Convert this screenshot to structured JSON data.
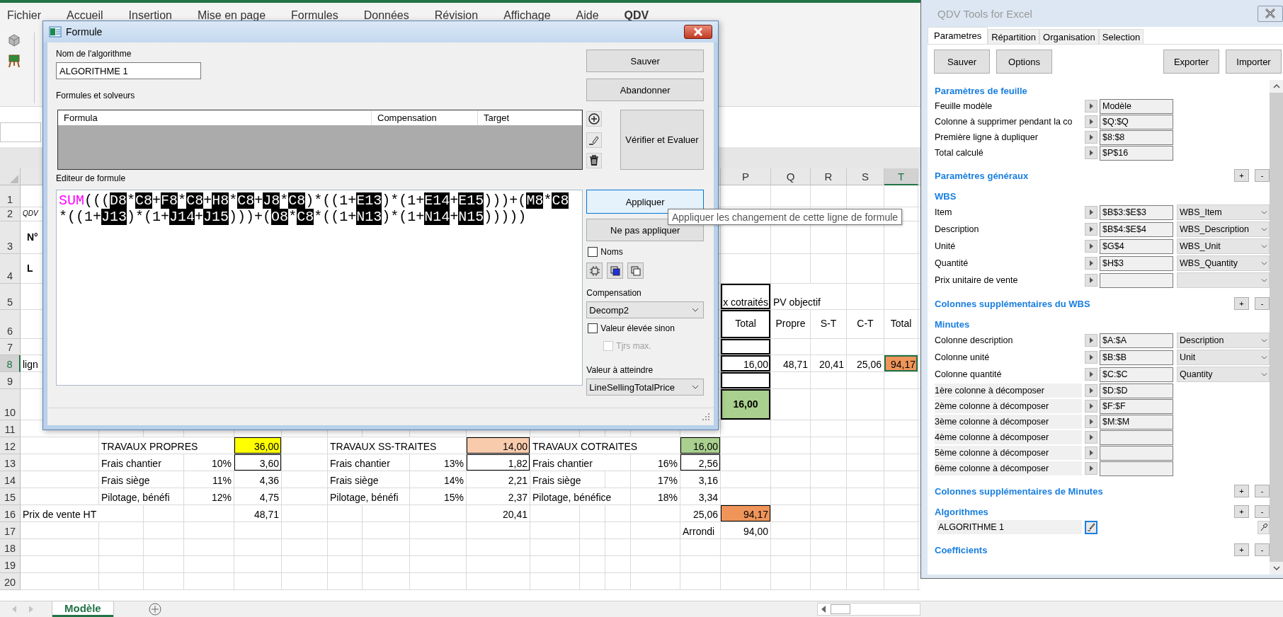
{
  "ribbon_tabs": [
    {
      "label": "Fichier",
      "selected": false
    },
    {
      "label": "Accueil",
      "selected": false
    },
    {
      "label": "Insertion",
      "selected": false
    },
    {
      "label": "Mise en page",
      "selected": false
    },
    {
      "label": "Formules",
      "selected": false
    },
    {
      "label": "Données",
      "selected": false
    },
    {
      "label": "Révision",
      "selected": false
    },
    {
      "label": "Affichage",
      "selected": false
    },
    {
      "label": "Aide",
      "selected": false
    },
    {
      "label": "QDV",
      "selected": true
    }
  ],
  "sheet": {
    "column_headers": [
      {
        "label": "P",
        "selected": false
      },
      {
        "label": "Q",
        "selected": false
      },
      {
        "label": "R",
        "selected": false
      },
      {
        "label": "S",
        "selected": false
      },
      {
        "label": "T",
        "selected": true
      }
    ],
    "rows": [
      {
        "number": "1",
        "selected": false
      },
      {
        "number": "2",
        "selected": false,
        "cells": [
          {
            "kind": "small",
            "text": "QDV"
          }
        ]
      },
      {
        "number": "3",
        "selected": false,
        "cells": [
          {
            "kind": "bold",
            "text": "N°"
          }
        ]
      },
      {
        "number": "4",
        "selected": false,
        "cells": [
          {
            "kind": "bold",
            "text": "L"
          }
        ]
      },
      {
        "number": "5",
        "selected": false,
        "cells": [
          {},
          {},
          {},
          {},
          {},
          {},
          {},
          {},
          {},
          {},
          {},
          {},
          {},
          {},
          {},
          {
            "kind": "number",
            "text": "x cotraités",
            "framed": true
          },
          {
            "kind": "text",
            "text": "PV objectif"
          }
        ]
      },
      {
        "number": "6",
        "selected": false,
        "cells": [
          {},
          {},
          {},
          {},
          {},
          {},
          {},
          {},
          {},
          {},
          {},
          {},
          {},
          {},
          {},
          {
            "kind": "center",
            "text": "Total",
            "framed": true
          },
          {
            "kind": "center",
            "text": "Propre"
          },
          {
            "kind": "center",
            "text": "S-T"
          },
          {
            "kind": "center",
            "text": "C-T"
          },
          {
            "kind": "center",
            "text": "Total"
          }
        ]
      },
      {
        "number": "7",
        "selected": false,
        "cells": [
          {},
          {},
          {},
          {},
          {},
          {},
          {},
          {},
          {},
          {},
          {},
          {},
          {},
          {},
          {},
          {
            "framed": true
          }
        ]
      },
      {
        "number": "8",
        "selected": true,
        "cells": [
          {
            "kind": "text",
            "text": "lign"
          },
          {},
          {},
          {},
          {},
          {},
          {},
          {},
          {},
          {},
          {},
          {},
          {},
          {},
          {},
          {
            "kind": "number",
            "text": "16,00",
            "framed": true
          },
          {
            "kind": "number",
            "text": "48,71"
          },
          {
            "kind": "number",
            "text": "20,41"
          },
          {
            "kind": "number",
            "text": "25,06"
          },
          {
            "kind": "number",
            "text": "94,17",
            "color": "#f0955a"
          }
        ]
      },
      {
        "number": "9",
        "selected": false,
        "cells": [
          {},
          {},
          {},
          {},
          {},
          {},
          {},
          {},
          {},
          {},
          {},
          {},
          {},
          {},
          {},
          {
            "framed": true
          }
        ]
      },
      {
        "number": "10",
        "selected": false,
        "cells": [
          {},
          {},
          {},
          {},
          {},
          {},
          {},
          {},
          {},
          {},
          {},
          {},
          {},
          {},
          {},
          {
            "kind": "total",
            "text": "16,00",
            "color": "#a9d08e",
            "framed": true
          }
        ]
      },
      {
        "number": "11",
        "selected": false
      },
      {
        "number": "12",
        "selected": false,
        "cells": [
          {},
          {
            "kind": "text",
            "text": "TRAVAUX PROPRES"
          },
          {},
          {},
          {
            "kind": "number",
            "text": "36,00",
            "color": "#ffff00",
            "outlined": true
          },
          {},
          {
            "kind": "text",
            "text": "TRAVAUX SS-TRAITES"
          },
          {},
          {},
          {
            "kind": "number",
            "text": "14,00",
            "color": "#f8cbad",
            "outlined": true
          },
          {
            "kind": "text",
            "text": "TRAVAUX COTRAITES"
          },
          {},
          {},
          {},
          {
            "kind": "number",
            "text": "16,00",
            "color": "#a9d08e",
            "outlined": true
          }
        ]
      },
      {
        "number": "13",
        "selected": false,
        "cells": [
          {},
          {
            "kind": "text",
            "text": "Frais chantier"
          },
          {},
          {
            "kind": "number",
            "text": "10%"
          },
          {
            "kind": "number",
            "text": "3,60",
            "outlined": true
          },
          {},
          {
            "kind": "text",
            "text": "Frais chantier"
          },
          {},
          {
            "kind": "number",
            "text": "13%"
          },
          {
            "kind": "number",
            "text": "1,82",
            "outlined": true
          },
          {
            "kind": "text",
            "text": "Frais chantier"
          },
          {},
          {},
          {
            "kind": "number",
            "text": "16%"
          },
          {
            "kind": "number",
            "text": "2,56",
            "outlined": true
          }
        ]
      },
      {
        "number": "14",
        "selected": false,
        "cells": [
          {},
          {
            "kind": "text",
            "text": "Frais siège"
          },
          {},
          {
            "kind": "number",
            "text": "11%"
          },
          {
            "kind": "number",
            "text": "4,36"
          },
          {},
          {
            "kind": "text",
            "text": "Frais siège"
          },
          {},
          {
            "kind": "number",
            "text": "14%"
          },
          {
            "kind": "number",
            "text": "2,21"
          },
          {
            "kind": "text",
            "text": "Frais siège"
          },
          {},
          {},
          {
            "kind": "number",
            "text": "17%"
          },
          {
            "kind": "number",
            "text": "3,16"
          }
        ]
      },
      {
        "number": "15",
        "selected": false,
        "cells": [
          {},
          {
            "kind": "text",
            "text": "Pilotage, bénéfi"
          },
          {},
          {
            "kind": "number",
            "text": "12%"
          },
          {
            "kind": "number",
            "text": "4,75"
          },
          {},
          {
            "kind": "text",
            "text": "Pilotage, bénéfi"
          },
          {},
          {
            "kind": "number",
            "text": "15%"
          },
          {
            "kind": "number",
            "text": "2,37"
          },
          {
            "kind": "text",
            "text": "Pilotage, bénéfice"
          },
          {},
          {},
          {
            "kind": "number",
            "text": "18%"
          },
          {
            "kind": "number",
            "text": "3,34"
          }
        ]
      },
      {
        "number": "16",
        "selected": false,
        "cells": [
          {
            "kind": "text",
            "text": "Prix de vente HT"
          },
          {},
          {},
          {},
          {
            "kind": "number",
            "text": "48,71"
          },
          {},
          {},
          {},
          {},
          {
            "kind": "number",
            "text": "20,41"
          },
          {},
          {},
          {},
          {},
          {
            "kind": "number",
            "text": "25,06"
          },
          {
            "kind": "number",
            "text": "94,17",
            "color": "#f0955a",
            "outlined": true
          }
        ]
      },
      {
        "number": "17",
        "selected": false,
        "cells": [
          {},
          {},
          {},
          {},
          {},
          {},
          {},
          {},
          {},
          {},
          {},
          {},
          {},
          {},
          {
            "kind": "text",
            "text": "Arrondi"
          },
          {
            "kind": "number",
            "text": "94,00"
          }
        ]
      },
      {
        "number": "18",
        "selected": false
      },
      {
        "number": "19",
        "selected": false
      },
      {
        "number": "20",
        "selected": false
      }
    ]
  },
  "sheet_tabs": [
    {
      "label": "Modèle",
      "selected": true
    }
  ],
  "formula_dialog": {
    "title": "Formule",
    "name_label": "Nom de l'algorithme",
    "name_value": "ALGORITHME 1",
    "list_label": "Formules et solveurs",
    "list_columns": [
      "Formula",
      "Compensation",
      "Target"
    ],
    "editor_label": "Editeur de formule",
    "formula_lines": [
      [
        {
          "kind": "function",
          "text": "SUM"
        },
        {
          "kind": "op",
          "text": "((("
        },
        {
          "kind": "ref",
          "text": "D8"
        },
        {
          "kind": "op",
          "text": "*"
        },
        {
          "kind": "ref",
          "text": "C8"
        },
        {
          "kind": "op",
          "text": "+"
        },
        {
          "kind": "ref",
          "text": "F8"
        },
        {
          "kind": "op",
          "text": "*"
        },
        {
          "kind": "ref",
          "text": "C8"
        },
        {
          "kind": "op",
          "text": "+"
        },
        {
          "kind": "ref",
          "text": "H8"
        },
        {
          "kind": "op",
          "text": "*"
        },
        {
          "kind": "ref",
          "text": "C8"
        },
        {
          "kind": "op",
          "text": "+"
        },
        {
          "kind": "ref",
          "text": "J8"
        },
        {
          "kind": "op",
          "text": "*"
        },
        {
          "kind": "ref",
          "text": "C8"
        },
        {
          "kind": "op",
          "text": ")*((1+"
        },
        {
          "kind": "ref",
          "text": "E13"
        },
        {
          "kind": "op",
          "text": ")*(1+"
        },
        {
          "kind": "ref",
          "text": "E14"
        },
        {
          "kind": "op",
          "text": "+"
        },
        {
          "kind": "ref",
          "text": "E15"
        },
        {
          "kind": "op",
          "text": ")))+("
        },
        {
          "kind": "ref",
          "text": "M8"
        },
        {
          "kind": "op",
          "text": "*"
        },
        {
          "kind": "ref",
          "text": "C8"
        }
      ],
      [
        {
          "kind": "op",
          "text": "*((1+"
        },
        {
          "kind": "ref",
          "text": "J13"
        },
        {
          "kind": "op",
          "text": ")*(1+"
        },
        {
          "kind": "ref",
          "text": "J14"
        },
        {
          "kind": "op",
          "text": "+"
        },
        {
          "kind": "ref",
          "text": "J15"
        },
        {
          "kind": "op",
          "text": ")))+("
        },
        {
          "kind": "ref",
          "text": "O8"
        },
        {
          "kind": "op",
          "text": "*"
        },
        {
          "kind": "ref",
          "text": "C8"
        },
        {
          "kind": "op",
          "text": "*((1+"
        },
        {
          "kind": "ref",
          "text": "N13"
        },
        {
          "kind": "op",
          "text": ")*(1+"
        },
        {
          "kind": "ref",
          "text": "N14"
        },
        {
          "kind": "op",
          "text": "+"
        },
        {
          "kind": "ref",
          "text": "N15"
        },
        {
          "kind": "op",
          "text": ")))))"
        }
      ]
    ],
    "save_button": {
      "label": "Sauver"
    },
    "cancel_button": {
      "label": "Abandonner"
    },
    "verify_button": {
      "label": "Vérifier et Evaluer"
    },
    "apply_button": {
      "label": "Appliquer",
      "hovered": true
    },
    "skip_button": {
      "label": "Ne pas appliquer",
      "hovered": false
    },
    "names_checkbox": {
      "label": "Noms",
      "checked": false,
      "disabled": false
    },
    "compensation_label": "Compensation",
    "compensation_value": "Decomp2",
    "higher_checkbox": {
      "label": "Valeur élevée sinon",
      "checked": false,
      "disabled": false
    },
    "max_checkbox": {
      "label": "Tjrs max.",
      "checked": false,
      "disabled": true
    },
    "target_label": "Valeur à atteindre",
    "target_value": "LineSellingTotalPrice"
  },
  "tooltip": "Appliquer les changement de cette ligne de formule",
  "qdv_panel": {
    "title": "QDV Tools for Excel",
    "tabs": [
      {
        "label": "Parametres",
        "selected": true
      },
      {
        "label": "Répartition",
        "selected": false
      },
      {
        "label": "Organisation",
        "selected": false
      },
      {
        "label": "Selection",
        "selected": false
      }
    ],
    "buttons_left": [
      "Sauver",
      "Options"
    ],
    "buttons_right": [
      "Exporter",
      "Importer"
    ],
    "sections": [
      {
        "heading": "Paramètres de feuille",
        "rows": [
          {
            "kind": "field",
            "label": "Feuille modèle",
            "value": "Modèle"
          },
          {
            "kind": "field",
            "label": "Colonne à supprimer pendant la co",
            "value": "$Q:$Q"
          },
          {
            "kind": "field",
            "label": "Première ligne à dupliquer",
            "value": "$8:$8"
          },
          {
            "kind": "field",
            "label": "Total calculé",
            "value": "$P$16"
          }
        ]
      },
      {
        "heading": "Paramètres généraux",
        "controls": [
          "+",
          "-"
        ]
      },
      {
        "heading": "WBS",
        "rows": [
          {
            "kind": "field_select",
            "label": "Item",
            "value": "$B$3:$E$3",
            "select": "WBS_Item"
          },
          {
            "kind": "field_select",
            "label": "Description",
            "value": "$B$4:$E$4",
            "select": "WBS_Description"
          },
          {
            "kind": "field_select",
            "label": "Unité",
            "value": "$G$4",
            "select": "WBS_Unit"
          },
          {
            "kind": "field_select",
            "label": "Quantité",
            "value": "$H$3",
            "select": "WBS_Quantity"
          },
          {
            "kind": "field_select",
            "label": "Prix unitaire de vente"
          }
        ]
      },
      {
        "heading": "Colonnes supplémentaires du WBS",
        "controls": [
          "+",
          "-"
        ]
      },
      {
        "heading": "Minutes",
        "rows": [
          {
            "kind": "field_select",
            "label": "Colonne description",
            "value": "$A:$A",
            "select": "Description"
          },
          {
            "kind": "field_select",
            "label": "Colonne unité",
            "value": "$B:$B",
            "select": "Unit"
          },
          {
            "kind": "field_select",
            "label": "Colonne quantité",
            "value": "$C:$C",
            "select": "Quantity"
          },
          {
            "kind": "field_shaded",
            "label": "1ère colonne à décomposer",
            "value": "$D:$D"
          },
          {
            "kind": "field_shaded",
            "label": "2ème colonne à décomposer",
            "value": "$F:$F"
          },
          {
            "kind": "field_shaded",
            "label": "3ème colonne à décomposer",
            "value": "$M:$M"
          },
          {
            "kind": "field_shaded",
            "label": "4ème colonne à décomposer"
          },
          {
            "kind": "field_shaded",
            "label": "5ème colonne à décomposer"
          },
          {
            "kind": "field_shaded",
            "label": "6ème colonne à décomposer"
          }
        ]
      },
      {
        "heading": "Colonnes supplémentaires de Minutes",
        "controls": [
          "+",
          "-"
        ]
      },
      {
        "heading": "Algorithmes",
        "controls": [
          "+",
          "-"
        ],
        "rows": [
          {
            "kind": "algorithm",
            "label": "ALGORITHME 1"
          }
        ]
      },
      {
        "heading": "Coefficients",
        "controls": [
          "+",
          "-"
        ]
      }
    ]
  }
}
